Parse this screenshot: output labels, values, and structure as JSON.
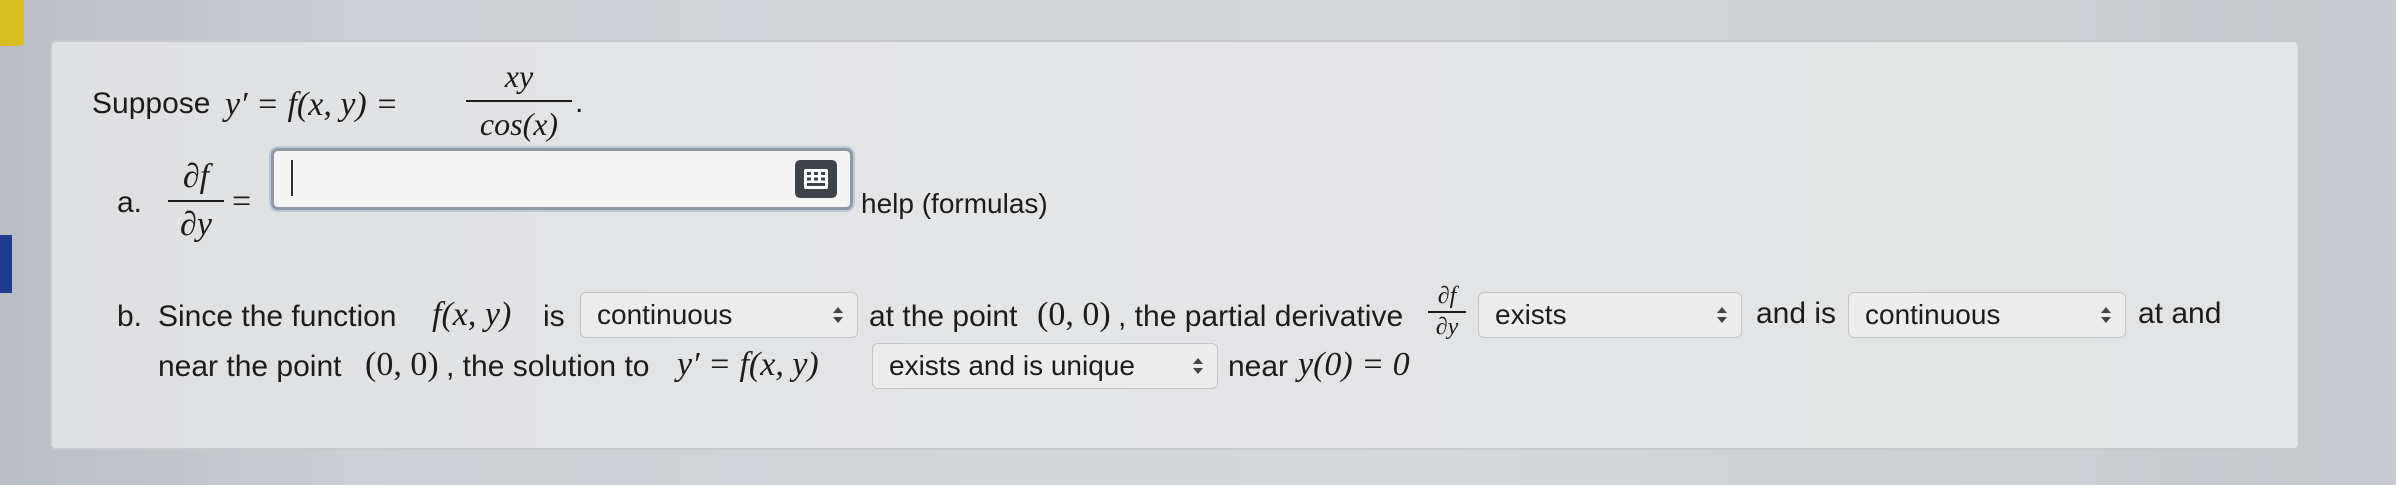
{
  "question": {
    "intro_word": "Suppose",
    "intro_lhs": "y′ = f(x, y) =",
    "intro_num": "xy",
    "intro_den": "cos(x)",
    "intro_end": "."
  },
  "part_a": {
    "label": "a.",
    "frac_num": "∂f",
    "frac_den": "∂y",
    "equals": "=",
    "input_value": "",
    "keyboard_icon": "keyboard-icon",
    "help_text": "help (formulas)"
  },
  "part_b": {
    "label": "b.",
    "text1": "Since the function",
    "fxy": "f(x, y)",
    "text2": "is",
    "select1": "continuous",
    "text3": "at the point",
    "point": "(0, 0)",
    "text4": ", the partial derivative",
    "partial_num": "∂f",
    "partial_den": "∂y",
    "select2": "exists",
    "text5": "and is",
    "select3": "continuous",
    "text6": "at and",
    "text7": "near the point",
    "point2": "(0, 0)",
    "text8": ", the solution to",
    "ode": "y′ = f(x, y)",
    "select4": "exists and is unique",
    "text9": "near",
    "init": "y(0) = 0"
  },
  "colors": {
    "panel_bg": "#e2e3e4",
    "tab_yellow": "#d8c023",
    "tab_blue": "#1f3c8f",
    "keyboard_button": "#3d4348"
  }
}
